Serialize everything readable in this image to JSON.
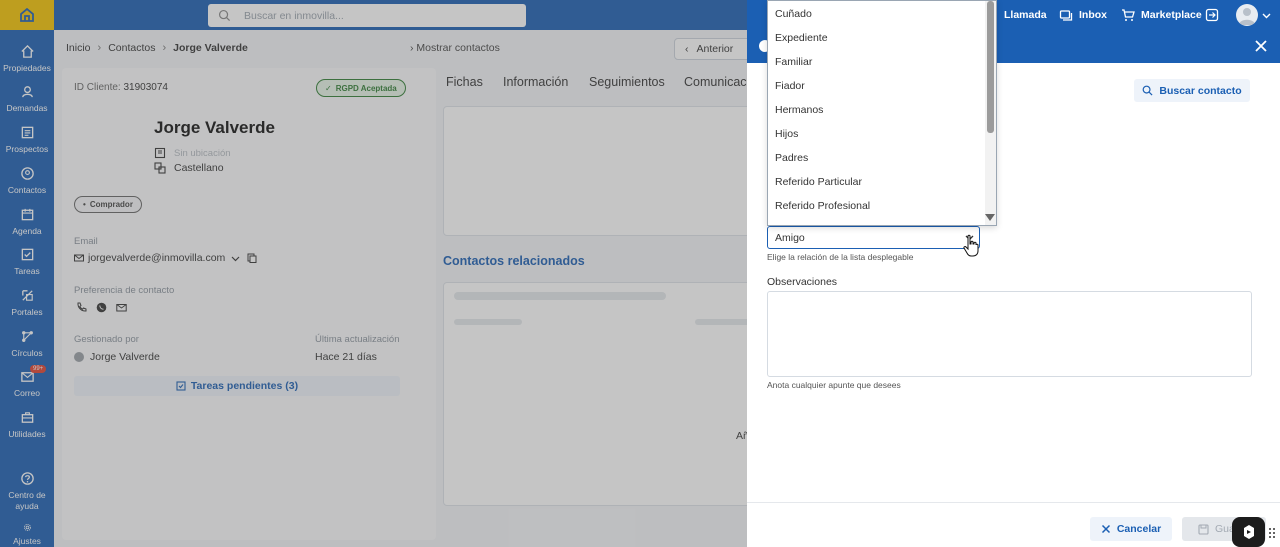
{
  "colors": {
    "brand_blue": "#1b5fb3",
    "logo_yellow": "#f5c400",
    "rgpd_green": "#2e7d32",
    "badge_red": "#e0412f"
  },
  "sidebar": {
    "items": [
      {
        "label": "Propiedades",
        "icon": "home-icon"
      },
      {
        "label": "Demandas",
        "icon": "demand-icon"
      },
      {
        "label": "Prospectos",
        "icon": "list-icon"
      },
      {
        "label": "Contactos",
        "icon": "contact-icon"
      },
      {
        "label": "Agenda",
        "icon": "calendar-icon"
      },
      {
        "label": "Tareas",
        "icon": "task-icon"
      },
      {
        "label": "Portales",
        "icon": "portal-icon"
      },
      {
        "label": "Círculos",
        "icon": "share-icon"
      },
      {
        "label": "Correo",
        "icon": "mail-icon",
        "badge": "99+"
      },
      {
        "label": "Utilidades",
        "icon": "toolbox-icon"
      }
    ],
    "bottom": [
      {
        "label": "Centro de ayuda",
        "icon": "help-icon"
      },
      {
        "label": "Ajustes",
        "icon": "gear-icon"
      }
    ]
  },
  "topbar": {
    "search_placeholder": "Buscar en inmovilla...",
    "llamada": "Llamada",
    "inbox": "Inbox",
    "marketplace": "Marketplace"
  },
  "breadcrumb": [
    "Inicio",
    "Contactos",
    "Jorge Valverde"
  ],
  "show_contacts": "Mostrar contactos",
  "prev_label": "Anterior",
  "contact": {
    "id_label": "ID Cliente:",
    "id_value": "31903074",
    "rgpd": "RGPD Aceptada",
    "name": "Jorge Valverde",
    "location": "Sin ubicación",
    "language": "Castellano",
    "tag": "Comprador",
    "email_label": "Email",
    "email": "jorgevalverde@inmovilla.com",
    "pref_label": "Preferencia de contacto",
    "managed_label": "Gestionado por",
    "managed_value": "Jorge Valverde",
    "updated_label": "Última actualización",
    "updated_value": "Hace 21 días",
    "tasks": "Tareas pendientes (3)"
  },
  "tabs": [
    "Fichas",
    "Información",
    "Seguimientos",
    "Comunicaci"
  ],
  "related_title": "Contactos relacionados",
  "related_partial": "Añ",
  "panel": {
    "find_contact": "Buscar contacto",
    "selected_relation": "Amigo",
    "relation_hint": "Elige la relación de la lista desplegable",
    "obs_label": "Observaciones",
    "obs_hint": "Anota cualquier apunte que desees",
    "cancel": "Cancelar",
    "save": "Guar"
  },
  "dropdown_options": [
    "Cuñado",
    "Expediente",
    "Familiar",
    "Fiador",
    "Hermanos",
    "Hijos",
    "Padres",
    "Referido Particular",
    "Referido Profesional"
  ]
}
